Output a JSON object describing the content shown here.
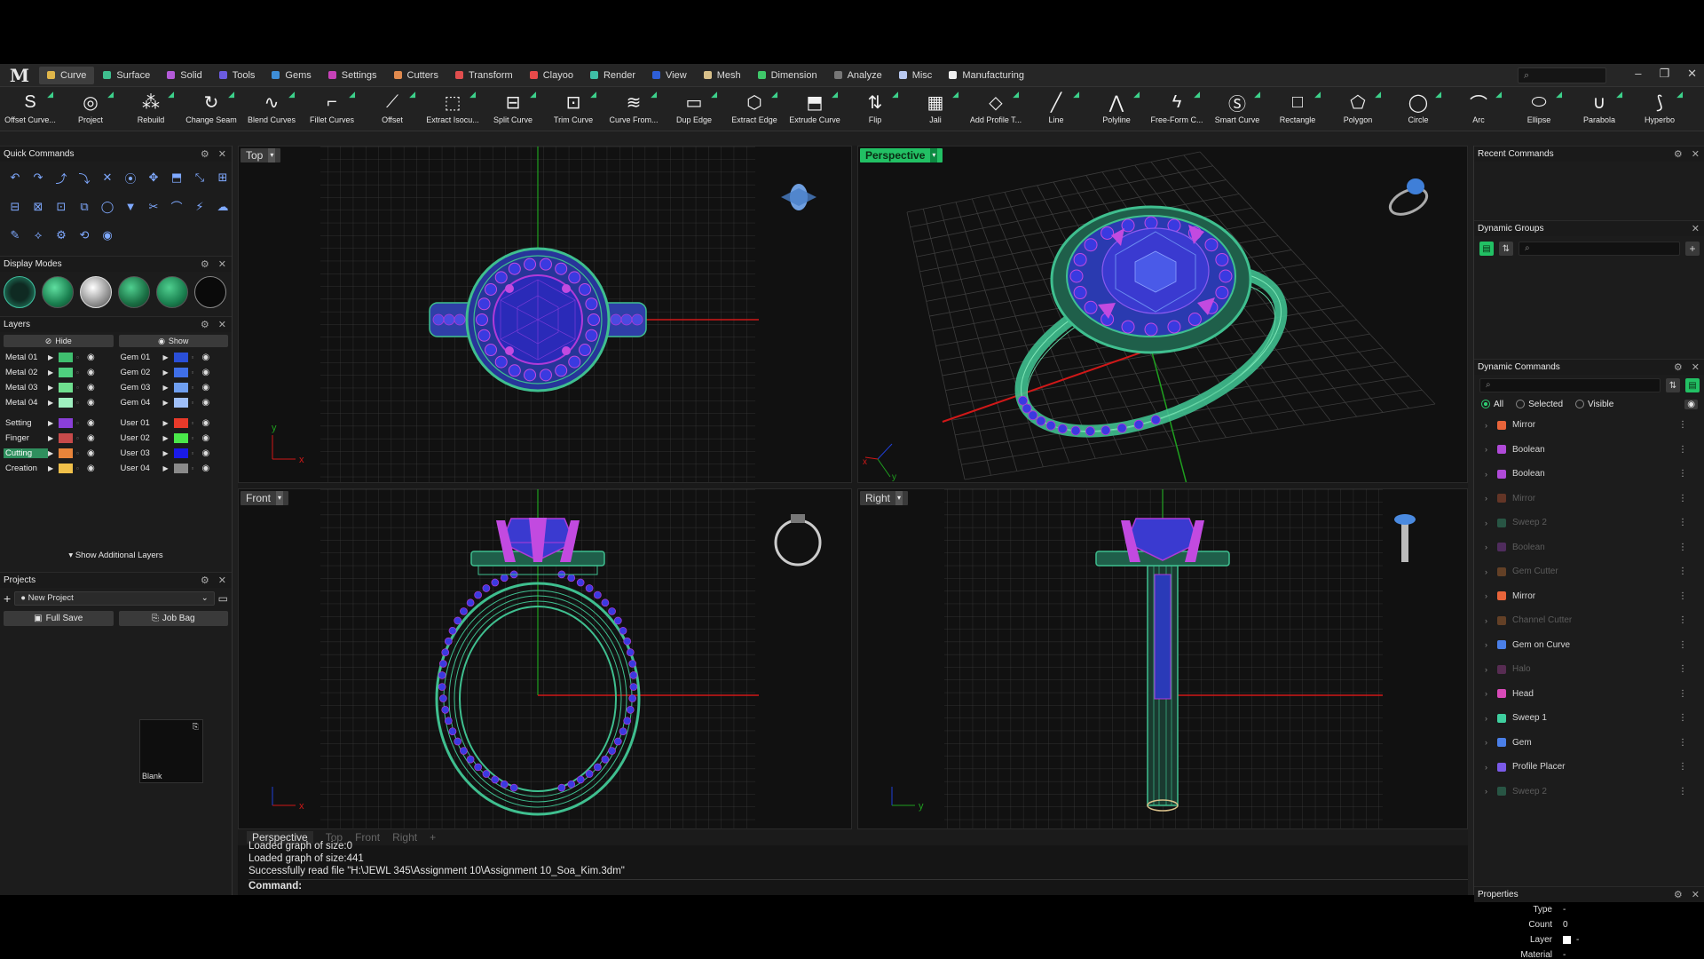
{
  "app": {
    "logo": "M"
  },
  "tabs": [
    {
      "label": "Curve",
      "color": "#e0b64a",
      "active": true
    },
    {
      "label": "Surface",
      "color": "#3fbf8f"
    },
    {
      "label": "Solid",
      "color": "#b35ad8"
    },
    {
      "label": "Tools",
      "color": "#6b5be0"
    },
    {
      "label": "Gems",
      "color": "#3e8ed8"
    },
    {
      "label": "Settings",
      "color": "#c742b8"
    },
    {
      "label": "Cutters",
      "color": "#e08a4e"
    },
    {
      "label": "Transform",
      "color": "#e04e4e"
    },
    {
      "label": "Clayoo",
      "color": "#e84a4a"
    },
    {
      "label": "Render",
      "color": "#3fbfa7"
    },
    {
      "label": "View",
      "color": "#2e5fd8"
    },
    {
      "label": "Mesh",
      "color": "#d8c08a"
    },
    {
      "label": "Dimension",
      "color": "#3fc76a"
    },
    {
      "label": "Analyze",
      "color": "#777777"
    },
    {
      "label": "Misc",
      "color": "#b8c8f0"
    },
    {
      "label": "Manufacturing",
      "color": "#f0f0f0"
    }
  ],
  "search": {
    "placeholder": "⌕"
  },
  "window_controls": [
    "–",
    "❐",
    "✕"
  ],
  "toolbar": [
    {
      "label": "Offset Curve...",
      "icon": "S"
    },
    {
      "label": "Project",
      "icon": "◎"
    },
    {
      "label": "Rebuild",
      "icon": "⁂"
    },
    {
      "label": "Change Seam",
      "icon": "↻"
    },
    {
      "label": "Blend Curves",
      "icon": "∿"
    },
    {
      "label": "Fillet Curves",
      "icon": "⌐"
    },
    {
      "label": "Offset",
      "icon": "⟋"
    },
    {
      "label": "Extract Isocu...",
      "icon": "⬚"
    },
    {
      "label": "Split Curve",
      "icon": "⊟"
    },
    {
      "label": "Trim Curve",
      "icon": "⊡"
    },
    {
      "label": "Curve From...",
      "icon": "≋"
    },
    {
      "label": "Dup Edge",
      "icon": "▭"
    },
    {
      "label": "Extract Edge",
      "icon": "⬡"
    },
    {
      "label": "Extrude Curve",
      "icon": "⬒"
    },
    {
      "label": "Flip",
      "icon": "⇅"
    },
    {
      "label": "Jali",
      "icon": "▦"
    },
    {
      "label": "Add Profile T...",
      "icon": "◇"
    },
    {
      "label": "Line",
      "icon": "╱"
    },
    {
      "label": "Polyline",
      "icon": "⋀"
    },
    {
      "label": "Free-Form C...",
      "icon": "ϟ"
    },
    {
      "label": "Smart Curve",
      "icon": "Ⓢ"
    },
    {
      "label": "Rectangle",
      "icon": "□"
    },
    {
      "label": "Polygon",
      "icon": "⬠"
    },
    {
      "label": "Circle",
      "icon": "◯"
    },
    {
      "label": "Arc",
      "icon": "⌒"
    },
    {
      "label": "Ellipse",
      "icon": "⬭"
    },
    {
      "label": "Parabola",
      "icon": "∪"
    },
    {
      "label": "Hyperbo",
      "icon": "⟆"
    }
  ],
  "panels": {
    "quick_commands": "Quick Commands",
    "display_modes": "Display Modes",
    "layers": "Layers",
    "projects": "Projects",
    "recent_commands": "Recent Commands",
    "dynamic_groups": "Dynamic Groups",
    "dynamic_commands": "Dynamic Commands",
    "properties": "Properties"
  },
  "quick_command_icons": [
    "↶",
    "↷",
    "⤴",
    "⤵",
    "✕",
    "⦿",
    "✥",
    "⬒",
    "⤡",
    "⊞",
    "⊟",
    "⊠",
    "⊡",
    "⧉",
    "◯",
    "▼",
    "✂",
    "⌒",
    "⚡",
    "☁",
    "✎",
    "⟡",
    "⚙",
    "⟲",
    "◉"
  ],
  "layers": {
    "hide": "Hide",
    "show": "Show",
    "show_additional": "Show Additional Layers",
    "left": [
      {
        "name": "Metal 01",
        "color": "#3fbf6f"
      },
      {
        "name": "Metal 02",
        "color": "#4fcf7f"
      },
      {
        "name": "Metal 03",
        "color": "#6fdf8f"
      },
      {
        "name": "Metal 04",
        "color": "#9fefbf"
      },
      {
        "name": "Setting",
        "color": "#8a3fd8"
      },
      {
        "name": "Finger",
        "color": "#c74a4a"
      },
      {
        "name": "Cutting",
        "color": "#e8843a",
        "selected": true
      },
      {
        "name": "Creation",
        "color": "#f0c04a"
      }
    ],
    "right": [
      {
        "name": "Gem 01",
        "color": "#2a4fd8"
      },
      {
        "name": "Gem 02",
        "color": "#3f6fe8"
      },
      {
        "name": "Gem 03",
        "color": "#6f9ff0"
      },
      {
        "name": "Gem 04",
        "color": "#9fbff8"
      },
      {
        "name": "User 01",
        "color": "#e83a2a"
      },
      {
        "name": "User 02",
        "color": "#4ae84a"
      },
      {
        "name": "User 03",
        "color": "#1a1ae8"
      },
      {
        "name": "User 04",
        "color": "#8a8a8a"
      }
    ]
  },
  "projects": {
    "selected": "New Project",
    "full_save": "Full Save",
    "job_bag": "Job Bag",
    "thumb_label": "Blank"
  },
  "viewports": {
    "top": "Top",
    "perspective": "Perspective",
    "front": "Front",
    "right": "Right"
  },
  "viewport_tabs": [
    {
      "label": "Perspective",
      "active": true
    },
    {
      "label": "Top"
    },
    {
      "label": "Front"
    },
    {
      "label": "Right"
    },
    {
      "label": "+"
    }
  ],
  "log": {
    "lines": [
      "Loaded graph of size:0",
      "Loaded graph of size:441",
      "Successfully read file \"H:\\JEWL 345\\Assignment 10\\Assignment 10_Soa_Kim.3dm\""
    ],
    "command_label": "Command:"
  },
  "dynamic_commands": {
    "search_placeholder": "⌕",
    "filters": [
      {
        "label": "All",
        "on": true
      },
      {
        "label": "Selected"
      },
      {
        "label": "Visible"
      }
    ],
    "items": [
      {
        "label": "Mirror",
        "color": "#e8643a"
      },
      {
        "label": "Boolean",
        "color": "#b04ad8"
      },
      {
        "label": "Boolean",
        "color": "#b04ad8"
      },
      {
        "label": "Mirror",
        "color": "#e8643a",
        "dim": true
      },
      {
        "label": "Sweep 2",
        "color": "#3fbf8f",
        "dim": true
      },
      {
        "label": "Boolean",
        "color": "#b04ad8",
        "dim": true
      },
      {
        "label": "Gem Cutter",
        "color": "#e8843a",
        "dim": true
      },
      {
        "label": "Mirror",
        "color": "#e8643a"
      },
      {
        "label": "Channel Cutter",
        "color": "#e8843a",
        "dim": true
      },
      {
        "label": "Gem on Curve",
        "color": "#4a7fe8"
      },
      {
        "label": "Halo",
        "color": "#c74ab8",
        "dim": true
      },
      {
        "label": "Head",
        "color": "#d84ab8"
      },
      {
        "label": "Sweep 1",
        "color": "#3fcf9f"
      },
      {
        "label": "Gem",
        "color": "#4a7fe8"
      },
      {
        "label": "Profile Placer",
        "color": "#7a5ae8"
      },
      {
        "label": "Sweep 2",
        "color": "#3fbf8f",
        "dim": true
      }
    ]
  },
  "properties": [
    {
      "key": "Type",
      "value": "-"
    },
    {
      "key": "Count",
      "value": "0"
    },
    {
      "key": "Layer",
      "value": "-"
    },
    {
      "key": "Material",
      "value": "-"
    }
  ],
  "colors": {
    "accent": "#22c064",
    "metal": "#3fbf8f",
    "gem": "#3a4fd8",
    "prong": "#b43ad8",
    "axis_x": "#e02020",
    "axis_y": "#20b020"
  }
}
